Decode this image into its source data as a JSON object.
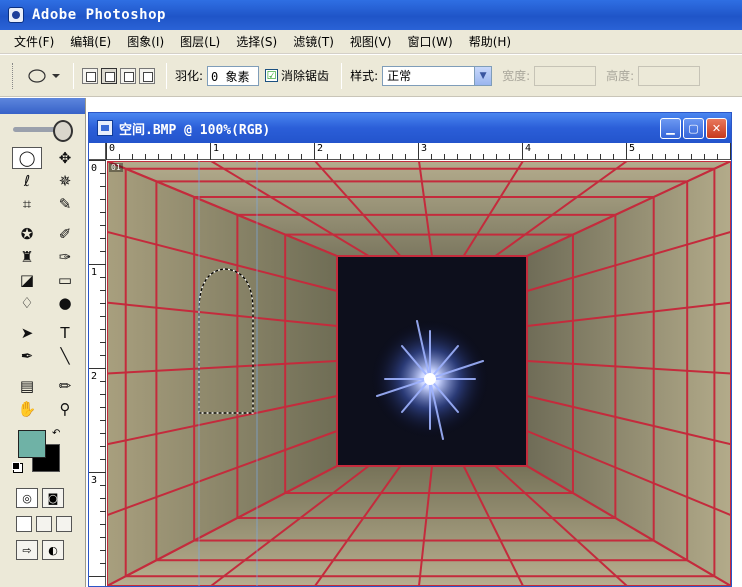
{
  "app": {
    "title": "Adobe Photoshop"
  },
  "menu": [
    "文件(F)",
    "编辑(E)",
    "图象(I)",
    "图层(L)",
    "选择(S)",
    "滤镜(T)",
    "视图(V)",
    "窗口(W)",
    "帮助(H)"
  ],
  "options": {
    "feather_label": "羽化:",
    "feather_value": "0 象素",
    "antialias_label": "消除锯齿",
    "antialias_checked": "☑",
    "style_label": "样式:",
    "style_value": "正常",
    "width_label": "宽度:",
    "height_label": "高度:"
  },
  "document": {
    "title": "空间.BMP @ 100%(RGB)",
    "badge": "01",
    "ruler_top": [
      "0",
      "1",
      "2",
      "3",
      "4",
      "5"
    ],
    "ruler_left": [
      "0",
      "1",
      "2",
      "3"
    ]
  },
  "colors": {
    "foreground": "#6fb2a6",
    "background": "#000000",
    "grid": "#c42b3c"
  },
  "icons": {
    "window_buttons": [
      "minimize-icon",
      "maximize-icon",
      "close-icon"
    ]
  }
}
